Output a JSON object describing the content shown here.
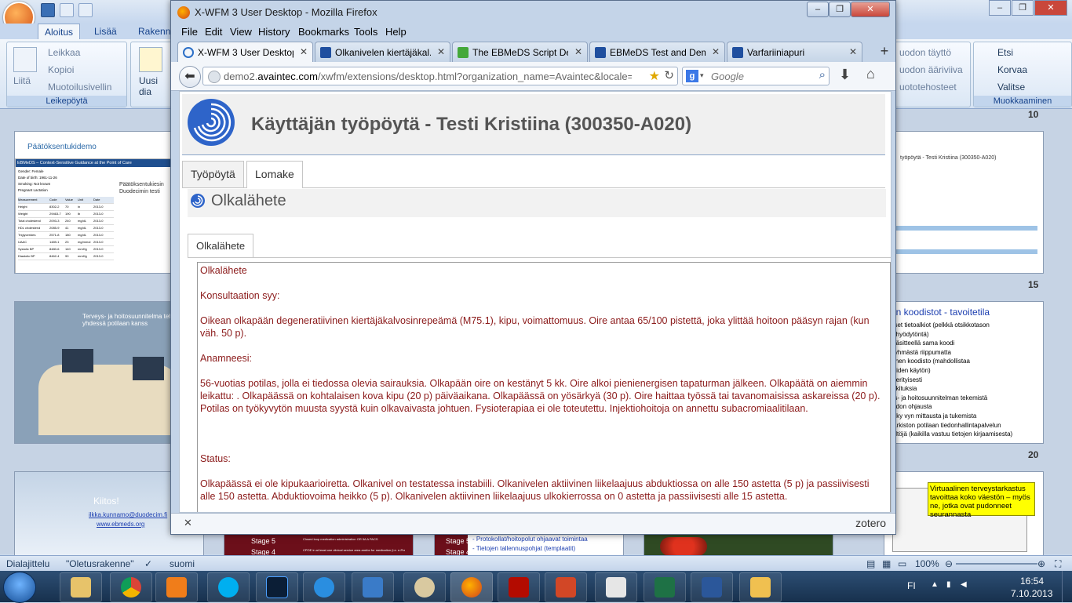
{
  "powerpoint": {
    "tabs": [
      "Aloitus",
      "Lisää",
      "Rakenne"
    ],
    "clipboard": {
      "paste": "Liitä",
      "cut": "Leikkaa",
      "copy": "Kopioi",
      "format_painter": "Muotoilusivellin",
      "group": "Leikepöytä"
    },
    "new_slide": "Uusi dia",
    "right_group": {
      "fill": "uodon täyttö",
      "outline": "uodon ääriviiva",
      "effects": "uototehosteet"
    },
    "editing": {
      "find": "Etsi",
      "replace": "Korvaa",
      "select": "Valitse",
      "group": "Muokkaaminen"
    },
    "slide_numbers": [
      "10",
      "15",
      "20"
    ],
    "slides": {
      "demo_title": "Päätöksentukidemo",
      "demo_banner": "EBMeDS – Context-Sensitive Guidance at the Point of Care",
      "demo_side": "Päätöksentukiesin Duodecimin testi",
      "demo_form_labels": [
        "Gender:",
        "Date of birth:",
        "Smoking:",
        "Pregnant"
      ],
      "demo_form_values": [
        "Female",
        "1961-11-26",
        "Not known",
        "Lactation"
      ],
      "demo_table_header": [
        "Measurement",
        "Code",
        "Value",
        "Unit",
        "Date"
      ],
      "demo_table_rows": [
        [
          "Height",
          "8302-2",
          "70",
          "in",
          "2013-0"
        ],
        [
          "Weight",
          "29463-7",
          "190",
          "lb",
          "2013-0"
        ],
        [
          "Total cholesterol",
          "2093-3",
          "240",
          "mg/dL",
          "2013-0"
        ],
        [
          "HDL cholesterol",
          "2085-9",
          "41",
          "mg/dL",
          "2013-0"
        ],
        [
          "Triglycerides",
          "2571-8",
          "180",
          "mg/dL",
          "2013-0"
        ],
        [
          "UAAC",
          "1489-1",
          "23",
          "mg/mmol",
          "2013-0"
        ],
        [
          "Systolic BP",
          "8480-6",
          "140",
          "mmHg",
          "2013-0"
        ],
        [
          "Diastolic BP",
          "8462-4",
          "90",
          "mmHg",
          "2013-0"
        ]
      ],
      "photo_caption": "Terveys- ja hoitosuunnitelma tehdään yhdessä potilaan kanss",
      "thanks": "Kiitos!",
      "email": "ilkka.kunnamo@duodecim.fi",
      "site": "www.ebmeds.org",
      "right_title": "työpöytä - Testi Kristiina (300350-A020)",
      "koodisto_title": "rön koodistot - tavoitetila",
      "koodisto_lines": [
        "teiset tietoalkiot (pelkkä otsikkotason",
        "us hyödytöntä)",
        "a käsitteellä sama koodi",
        "ttiryhmästä riippumatta",
        "kkinen koodisto (mahdollistaa",
        "ttteiden käytön)",
        "va erityisesti",
        "iuokituksia",
        "eys- ja hoitosuunnitelman tekemistä",
        "hoidon ohjausta",
        "maky vyn mittausta ja tukemista",
        "a-arkiston potilaan tiedonhallintapalvelun",
        "isältöjä (kaikilla vastuu tietojen kirjaamisesta)"
      ],
      "stage5": "Stage 5",
      "stage4": "Stage 4",
      "stage_text_left": "Closed loop medication administration OR 5A A PACS",
      "stage_text_left2": "CPOE in at least one clinical service area and/or for medication (i.e. e-Prescribing)",
      "stage_text_mid1": "- Protokollat/hoitopolut ohjaavat toimintaa",
      "stage_text_mid2": "- Tietojen tallennuspohjat (templaatit)"
    },
    "status": {
      "section": "Dialajittelu",
      "theme": "\"Oletusrakenne\"",
      "language": "suomi",
      "zoom": "100%"
    }
  },
  "firefox": {
    "window_title": "X-WFM 3 User Desktop - Mozilla Firefox",
    "menu": [
      "File",
      "Edit",
      "View",
      "History",
      "Bookmarks",
      "Tools",
      "Help"
    ],
    "tabs": [
      {
        "label": "X-WFM 3 User Desktop",
        "icon": "avaintec-icon"
      },
      {
        "label": "Olkanivelen kiertäjäkal...",
        "icon": "duodecim-icon"
      },
      {
        "label": "The EBMeDS Script Des...",
        "icon": "puzzle-icon"
      },
      {
        "label": "EBMeDS Test and Dem...",
        "icon": "duodecim-icon"
      },
      {
        "label": "Varfariiniapuri",
        "icon": "duodecim-icon"
      }
    ],
    "url_prefix": "demo2.",
    "url_domain": "avaintec.com",
    "url_rest": "/xwfm/extensions/desktop.html?organization_name=Avaintec&locale=fi&ac",
    "search_placeholder": "Google",
    "zotero": "zotero"
  },
  "page": {
    "header": "Käyttäjän työpöytä - Testi Kristiina (300350-A020)",
    "tabs": [
      "Työpöytä",
      "Lomake"
    ],
    "form_title": "Olkalähete",
    "inner_tab": "Olkalähete",
    "text": [
      "Olkalähete",
      "Konsultaation syy:",
      "Oikean olkapään degeneratiivinen kiertäjäkalvosinrepeämä (M75.1), kipu, voimattomuus. Oire antaa 65/100 pistettä, joka ylittää hoitoon pääsyn rajan (kun väh. 50 p).",
      "Anamneesi:",
      "56-vuotias potilas, jolla ei tiedossa olevia sairauksia. Olkapään oire on kestänyt 5 kk. Oire alkoi pienienergisen tapaturman jälkeen. Olkapäätä on aiemmin leikattu: . Olkapäässä on kohtalaisen kova kipu (20 p) päiväaikana. Olkapäässä on yösärkyä (30 p). Oire haittaa työssä tai tavanomaisissa askareissa (20 p). Potilas on työkyvytön muusta syystä kuin olkavaivasta johtuen. Fysioterapiaa ei ole toteutettu. Injektiohoitoja on annettu subacromiaalitilaan.",
      "Status:",
      "Olkapäässä ei ole kipukaarioiretta. Olkanivel on testatessa instabiili. Olkanivelen aktiivinen liikelaajuus abduktiossa on alle 150 astetta (5 p) ja passiivisesti alle 150 astetta. Abduktiovoima heikko (5 p). Olkanivelen aktiivinen liikelaajuus ulkokierrossa on 0 astetta ja passiivisesti alle 15 astetta."
    ]
  },
  "tooltip": "Virtuaalinen terveystarkastus tavoittaa koko väestön – myös ne, jotka ovat pudonneet seurannasta",
  "tray": {
    "language": "FI",
    "time": "16:54",
    "date": "7.10.2013"
  },
  "colors": {
    "form_text": "#8b1a1a",
    "header_text": "#555555",
    "tooltip_bg": "#ffff00"
  }
}
